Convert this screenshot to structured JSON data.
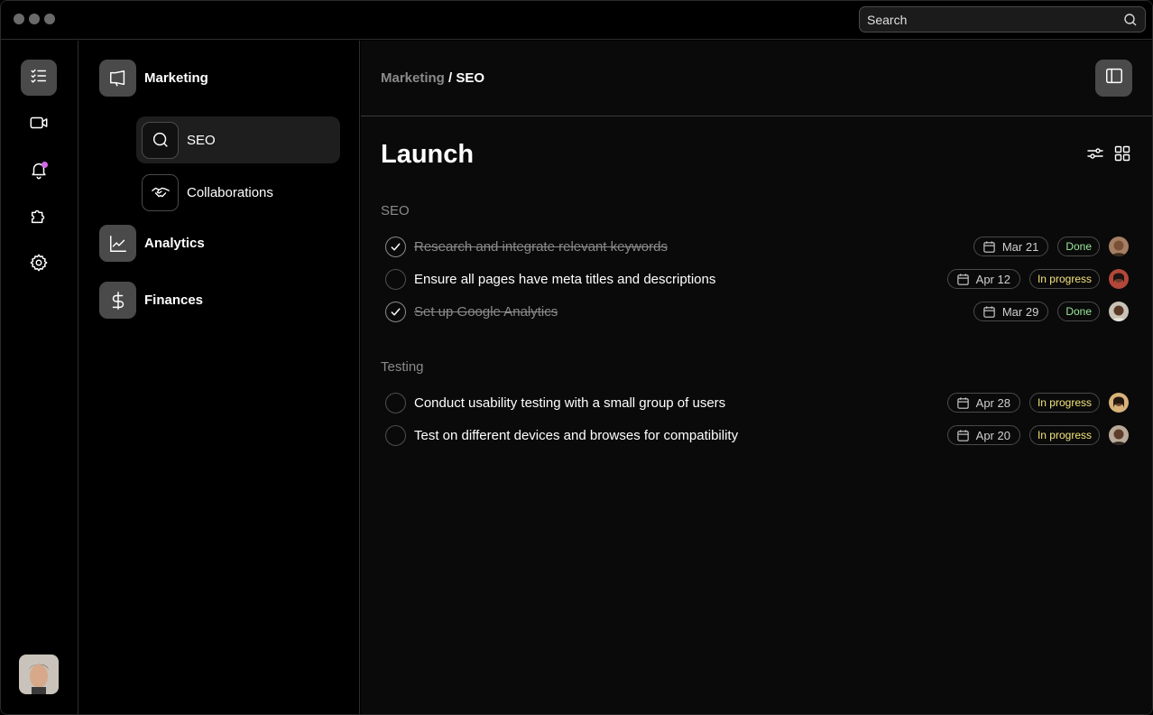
{
  "search": {
    "placeholder": "Search",
    "icon": "search-icon"
  },
  "rail": {
    "items": [
      {
        "name": "tasks",
        "icon": "checklist-icon",
        "active": true
      },
      {
        "name": "video",
        "icon": "video-icon"
      },
      {
        "name": "notifications",
        "icon": "bell-icon",
        "has_badge": true
      },
      {
        "name": "integrations",
        "icon": "puzzle-icon"
      },
      {
        "name": "settings",
        "icon": "gear-icon"
      }
    ],
    "user_avatar": "user-avatar"
  },
  "sidebar": {
    "projects": [
      {
        "label": "Marketing",
        "icon": "megaphone-icon"
      },
      {
        "label": "Analytics",
        "icon": "chart-line-icon"
      },
      {
        "label": "Finances",
        "icon": "dollar-icon"
      }
    ],
    "marketing_children": [
      {
        "label": "SEO",
        "icon": "search-icon",
        "active": true
      },
      {
        "label": "Collaborations",
        "icon": "handshake-icon"
      }
    ]
  },
  "breadcrumb": {
    "parent": "Marketing",
    "separator": " / ",
    "current": "SEO"
  },
  "page": {
    "title": "Launch"
  },
  "sections": [
    {
      "title": "SEO",
      "tasks": [
        {
          "text": "Research and integrate relevant keywords",
          "done": true,
          "date": "Mar 21",
          "status": "Done"
        },
        {
          "text": "Ensure all pages have meta titles and descriptions",
          "done": false,
          "date": "Apr 12",
          "status": "In progress"
        },
        {
          "text": "Set up Google Analytics",
          "done": true,
          "date": "Mar 29",
          "status": "Done"
        }
      ]
    },
    {
      "title": "Testing",
      "tasks": [
        {
          "text": "Conduct usability testing with a small group of users",
          "done": false,
          "date": "Apr 28",
          "status": "In progress"
        },
        {
          "text": "Test on different devices and browses for compatibility",
          "done": false,
          "date": "Apr 20",
          "status": "In progress"
        }
      ]
    }
  ],
  "colors": {
    "accent_dot": "#d46ae8",
    "status_done": "#9be89b",
    "status_in_progress": "#f2e27a"
  }
}
